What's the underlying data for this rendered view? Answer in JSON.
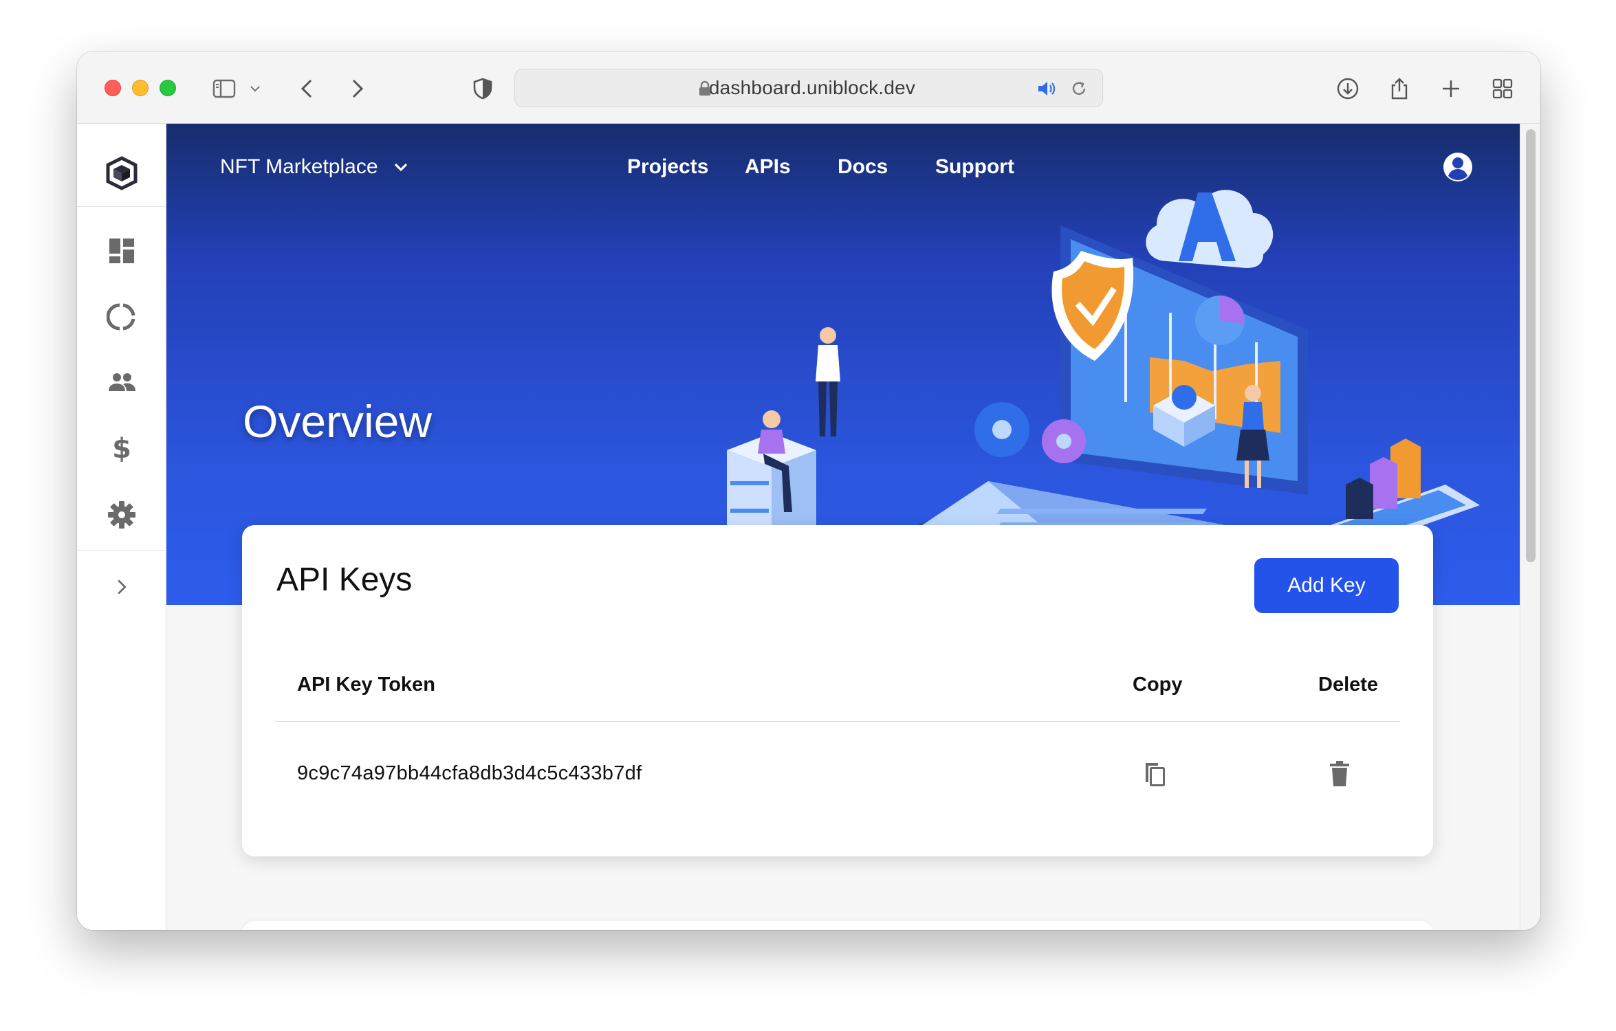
{
  "browser": {
    "url": "dashboard.uniblock.dev"
  },
  "nav": {
    "project": "NFT Marketplace",
    "links": [
      "Projects",
      "APIs",
      "Docs",
      "Support"
    ]
  },
  "hero": {
    "title": "Overview"
  },
  "api_keys": {
    "title": "API Keys",
    "add_button": "Add Key",
    "columns": {
      "token": "API Key Token",
      "copy": "Copy",
      "delete": "Delete"
    },
    "rows": [
      {
        "token": "9c9c74a97bb44cfa8db3d4c5c433b7df"
      }
    ]
  },
  "sidebar": {
    "items": [
      "logo-icon",
      "dashboard-icon",
      "donut-chart-icon",
      "users-icon",
      "dollar-icon",
      "gear-icon",
      "chevron-right-icon"
    ],
    "dollar_glyph": "$"
  },
  "colors": {
    "accent": "#2453ea",
    "hero_top": "#172d6d",
    "hero_bottom": "#2d5ded",
    "sidebar_icon": "#6a6a6a"
  }
}
